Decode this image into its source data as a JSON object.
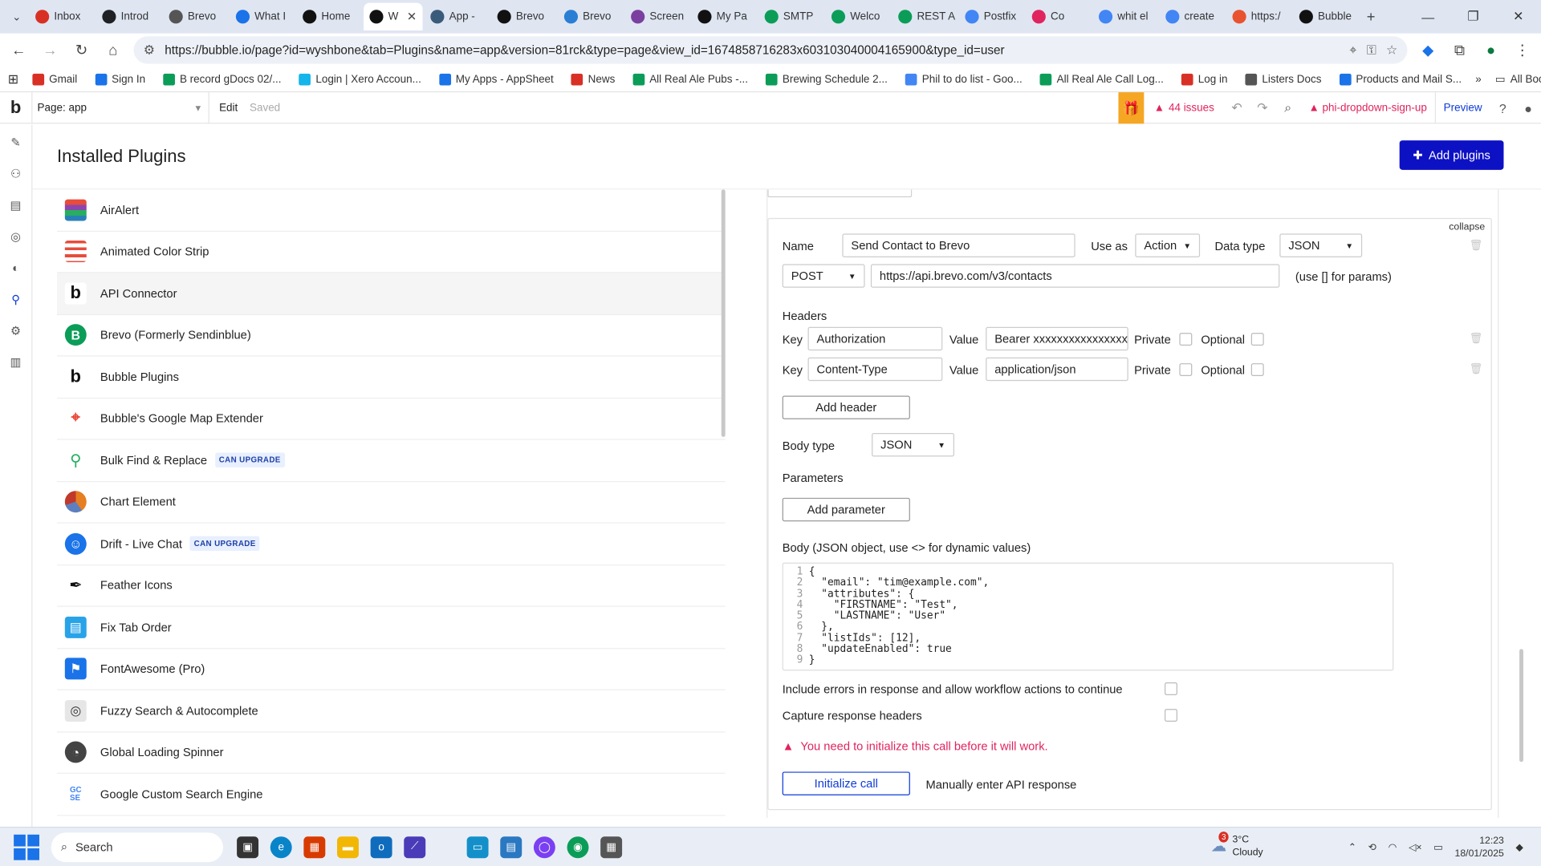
{
  "browser": {
    "tabs": [
      {
        "label": "Inbox",
        "color": "#d93025"
      },
      {
        "label": "Introd",
        "color": "#202124"
      },
      {
        "label": "Brevo",
        "color": "#555555"
      },
      {
        "label": "What I",
        "color": "#1a73e8"
      },
      {
        "label": "Home",
        "color": "#111111"
      },
      {
        "label": "W",
        "color": "#111111",
        "active": true
      },
      {
        "label": "App -",
        "color": "#3b5b7a"
      },
      {
        "label": "Brevo",
        "color": "#111111"
      },
      {
        "label": "Brevo",
        "color": "#2a7fd4"
      },
      {
        "label": "Screen",
        "color": "#7b3fa0"
      },
      {
        "label": "My Pa",
        "color": "#111111"
      },
      {
        "label": "SMTP",
        "color": "#0b9d58"
      },
      {
        "label": "Welco",
        "color": "#0b9d58"
      },
      {
        "label": "REST A",
        "color": "#0b9d58"
      },
      {
        "label": "Postfix",
        "color": "#4285f4"
      },
      {
        "label": "Co",
        "color": "#e0245e"
      },
      {
        "label": "whit el",
        "color": "#4285f4"
      },
      {
        "label": "create",
        "color": "#4285f4"
      },
      {
        "label": "https:/",
        "color": "#e8542f"
      },
      {
        "label": "Bubble",
        "color": "#111111"
      }
    ],
    "new_tab": "+",
    "url": "https://bubble.io/page?id=wyshbone&tab=Plugins&name=app&version=81rck&type=page&view_id=1674858716283x603103040004165900&type_id=user",
    "bookmarks": [
      {
        "label": "Gmail",
        "color": "#d93025"
      },
      {
        "label": "Sign In",
        "color": "#1a73e8"
      },
      {
        "label": "B record gDocs 02/...",
        "color": "#0b9d58"
      },
      {
        "label": "Login | Xero Accoun...",
        "color": "#13b5ea"
      },
      {
        "label": "My Apps - AppSheet",
        "color": "#1a73e8"
      },
      {
        "label": "News",
        "color": "#d93025"
      },
      {
        "label": "All Real Ale Pubs -...",
        "color": "#0b9d58"
      },
      {
        "label": "Brewing Schedule 2...",
        "color": "#0b9d58"
      },
      {
        "label": "Phil to do list - Goo...",
        "color": "#4285f4"
      },
      {
        "label": "All Real Ale Call Log...",
        "color": "#0b9d58"
      },
      {
        "label": "Log in",
        "color": "#d93025"
      },
      {
        "label": "Listers Docs",
        "color": "#555555"
      },
      {
        "label": "Products and Mail S...",
        "color": "#1a73e8"
      }
    ],
    "bookmarks_more": "»",
    "all_bookmarks": "All Bookmarks"
  },
  "bubble": {
    "page_selector": "Page: app",
    "edit": "Edit",
    "saved": "Saved",
    "issues": "44 issues",
    "warning_page": "phi-dropdown-sign-up",
    "preview": "Preview"
  },
  "plugins": {
    "title": "Installed Plugins",
    "add_button": "Add plugins",
    "items": [
      {
        "name": "AirAlert",
        "badge": ""
      },
      {
        "name": "Animated Color Strip",
        "badge": ""
      },
      {
        "name": "API Connector",
        "badge": "",
        "selected": true
      },
      {
        "name": "Brevo (Formerly Sendinblue)",
        "badge": ""
      },
      {
        "name": "Bubble Plugins",
        "badge": ""
      },
      {
        "name": "Bubble's Google Map Extender",
        "badge": ""
      },
      {
        "name": "Bulk Find & Replace",
        "badge": "CAN UPGRADE"
      },
      {
        "name": "Chart Element",
        "badge": ""
      },
      {
        "name": "Drift - Live Chat",
        "badge": "CAN UPGRADE"
      },
      {
        "name": "Feather Icons",
        "badge": ""
      },
      {
        "name": "Fix Tab Order",
        "badge": ""
      },
      {
        "name": "FontAwesome (Pro)",
        "badge": ""
      },
      {
        "name": "Fuzzy Search & Autocomplete",
        "badge": ""
      },
      {
        "name": "Global Loading Spinner",
        "badge": ""
      },
      {
        "name": "Google Custom Search Engine",
        "badge": ""
      }
    ]
  },
  "api_call": {
    "collapse": "collapse",
    "name_label": "Name",
    "name_value": "Send Contact to Brevo",
    "use_as_label": "Use as",
    "use_as_value": "Action",
    "data_type_label": "Data type",
    "data_type_value": "JSON",
    "method": "POST",
    "endpoint": "https://api.brevo.com/v3/contacts",
    "params_hint": "(use [] for params)",
    "headers_label": "Headers",
    "headers": [
      {
        "key_label": "Key",
        "key": "Authorization",
        "value_label": "Value",
        "value": "Bearer xxxxxxxxxxxxxxxx",
        "private_label": "Private",
        "optional_label": "Optional"
      },
      {
        "key_label": "Key",
        "key": "Content-Type",
        "value_label": "Value",
        "value": "application/json",
        "private_label": "Private",
        "optional_label": "Optional"
      }
    ],
    "add_header": "Add header",
    "body_type_label": "Body type",
    "body_type_value": "JSON",
    "parameters_label": "Parameters",
    "add_parameter": "Add parameter",
    "body_label": "Body (JSON object, use <> for dynamic values)",
    "body_lines": [
      "{",
      "  \"email\": \"tim@example.com\",",
      "  \"attributes\": {",
      "    \"FIRSTNAME\": \"Test\",",
      "    \"LASTNAME\": \"User\"",
      "  },",
      "  \"listIds\": [12],",
      "  \"updateEnabled\": true",
      "}"
    ],
    "include_errors": "Include errors in response and allow workflow actions to continue",
    "capture_headers": "Capture response headers",
    "warning": "You need to initialize this call before it will work.",
    "initialize": "Initialize call",
    "manual": "Manually enter API response"
  },
  "taskbar": {
    "search": "Search",
    "weather_temp": "3°C",
    "weather_desc": "Cloudy",
    "weather_badge": "3",
    "time": "12:23",
    "date": "18/01/2025"
  }
}
